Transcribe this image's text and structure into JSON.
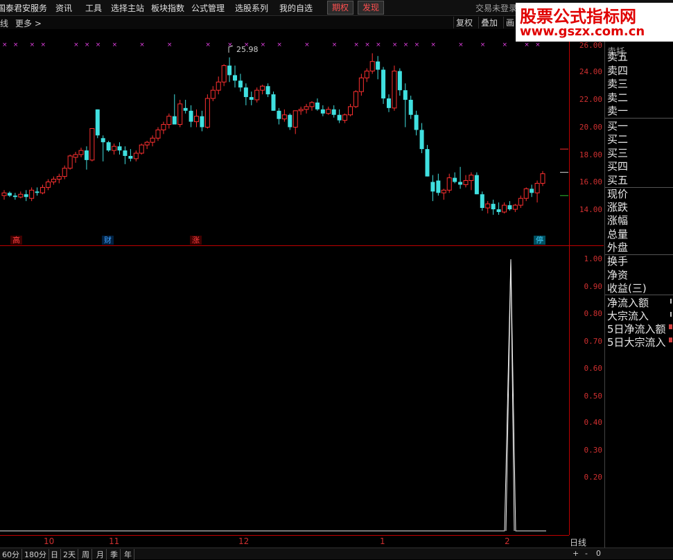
{
  "menu": {
    "items": [
      "国泰君安服务",
      "资讯",
      "工具",
      "选择主站",
      "板块指数",
      "公式管理",
      "选股系列",
      "我的自选"
    ],
    "buttons": [
      "期权",
      "发现"
    ],
    "status": "交易未登录"
  },
  "watermark": {
    "title": "股票公式指标网",
    "url": "www.gszx.com.cn"
  },
  "subbar": {
    "left_label": "线",
    "more_label": "更多",
    "more_icon": "chevron-right-icon",
    "buttons": [
      "复权",
      "叠加",
      "画"
    ]
  },
  "main_axis": {
    "ticks": [
      "26.00",
      "24.00",
      "22.00",
      "20.00",
      "18.00",
      "16.00",
      "14.00"
    ]
  },
  "sub_axis": {
    "ticks": [
      "1.00",
      "0.90",
      "0.80",
      "0.70",
      "0.60",
      "0.50",
      "0.40",
      "0.30",
      "0.20"
    ]
  },
  "badges": [
    {
      "text": "高",
      "color": "#ff4040"
    },
    {
      "text": "财",
      "color": "#40a0ff"
    },
    {
      "text": "涨",
      "color": "#ff4040"
    },
    {
      "text": "停",
      "color": "#40d0ff"
    }
  ],
  "annotation": {
    "high_label": "25.98"
  },
  "right_panel": {
    "top_label": "卖托",
    "sell": [
      "卖五",
      "卖四",
      "卖三",
      "卖二",
      "卖一"
    ],
    "buy": [
      "买一",
      "买二",
      "买三",
      "买四",
      "买五"
    ],
    "stats": [
      "现价",
      "涨跌",
      "涨幅",
      "总量",
      "外盘"
    ],
    "stats2": [
      "换手",
      "净资",
      "收益(三)"
    ],
    "flows": [
      "净流入额",
      "大宗流入",
      "5日净流入额",
      "5日大宗流入"
    ]
  },
  "xaxis": {
    "labels": [
      "10",
      "11",
      "12",
      "1",
      "2"
    ]
  },
  "period_label": "日线",
  "bottom_tabs": [
    "60分",
    "180分",
    "日",
    "2天",
    "周",
    "月",
    "季",
    "年"
  ],
  "zoom": {
    "plus": "+",
    "minus": "-",
    "value": "0"
  },
  "chart_data": [
    {
      "type": "candlestick",
      "title": "",
      "ylim": [
        13,
        26.3
      ],
      "ticks": [
        14,
        16,
        18,
        20,
        22,
        24,
        26
      ],
      "grid": false,
      "up_color": "#ff3030",
      "down_color": "#40e0e0",
      "candles": [
        [
          15.0,
          15.4,
          14.7,
          15.2
        ],
        [
          15.2,
          15.3,
          14.9,
          15.0
        ],
        [
          15.0,
          15.2,
          14.7,
          14.9
        ],
        [
          14.9,
          15.3,
          14.8,
          15.1
        ],
        [
          15.1,
          15.4,
          14.6,
          14.9
        ],
        [
          14.8,
          15.6,
          14.6,
          15.4
        ],
        [
          15.3,
          15.6,
          15.0,
          15.2
        ],
        [
          15.2,
          15.8,
          15.1,
          15.6
        ],
        [
          15.6,
          16.2,
          15.4,
          16.0
        ],
        [
          16.0,
          16.4,
          15.8,
          16.2
        ],
        [
          16.2,
          16.6,
          15.9,
          16.4
        ],
        [
          16.4,
          17.2,
          16.2,
          17.0
        ],
        [
          17.0,
          18.0,
          16.9,
          17.9
        ],
        [
          17.8,
          18.2,
          17.4,
          18.0
        ],
        [
          18.0,
          18.5,
          17.8,
          18.3
        ],
        [
          18.3,
          18.6,
          16.9,
          17.6
        ],
        [
          17.6,
          19.8,
          17.5,
          19.9
        ],
        [
          21.3,
          21.3,
          19.2,
          19.4
        ],
        [
          19.2,
          19.4,
          17.5,
          18.9
        ],
        [
          18.9,
          19.0,
          18.2,
          18.3
        ],
        [
          18.3,
          18.8,
          18.0,
          18.6
        ],
        [
          18.6,
          18.9,
          18.0,
          18.3
        ],
        [
          18.3,
          18.6,
          17.3,
          17.9
        ],
        [
          17.9,
          18.4,
          17.5,
          17.7
        ],
        [
          17.7,
          18.3,
          17.5,
          18.1
        ],
        [
          18.1,
          18.8,
          18.0,
          18.7
        ],
        [
          18.7,
          19.0,
          18.4,
          18.9
        ],
        [
          18.9,
          19.4,
          18.6,
          19.2
        ],
        [
          19.2,
          20.0,
          19.0,
          19.8
        ],
        [
          19.8,
          20.4,
          19.5,
          20.2
        ],
        [
          20.2,
          21.0,
          19.9,
          20.8
        ],
        [
          20.8,
          22.4,
          20.3,
          20.2
        ],
        [
          20.2,
          22.0,
          20.0,
          21.7
        ],
        [
          21.4,
          22.0,
          21.0,
          21.2
        ],
        [
          21.2,
          21.6,
          20.0,
          20.4
        ],
        [
          20.4,
          21.3,
          20.0,
          20.8
        ],
        [
          20.8,
          21.2,
          19.7,
          20.0
        ],
        [
          20.0,
          22.4,
          19.9,
          22.1
        ],
        [
          22.1,
          23.0,
          21.9,
          22.7
        ],
        [
          22.7,
          23.7,
          22.4,
          23.3
        ],
        [
          23.3,
          24.6,
          23.0,
          24.5
        ],
        [
          24.5,
          25.1,
          23.3,
          23.8
        ],
        [
          23.8,
          24.5,
          22.9,
          23.4
        ],
        [
          23.4,
          23.9,
          22.6,
          22.9
        ],
        [
          22.9,
          23.2,
          21.6,
          22.2
        ],
        [
          22.2,
          22.6,
          21.6,
          22.0
        ],
        [
          22.0,
          22.9,
          21.8,
          22.7
        ],
        [
          22.7,
          23.1,
          22.4,
          23.0
        ],
        [
          23.0,
          23.2,
          22.2,
          22.4
        ],
        [
          22.4,
          22.6,
          21.2,
          21.2
        ],
        [
          21.2,
          21.4,
          20.2,
          20.6
        ],
        [
          20.6,
          21.3,
          20.4,
          20.9
        ],
        [
          20.9,
          21.0,
          19.8,
          20.0
        ],
        [
          20.0,
          21.2,
          19.5,
          21.2
        ],
        [
          21.2,
          21.5,
          20.9,
          21.3
        ],
        [
          21.3,
          21.7,
          21.0,
          21.5
        ],
        [
          21.5,
          21.9,
          21.2,
          21.8
        ],
        [
          21.8,
          22.1,
          21.2,
          21.3
        ],
        [
          21.3,
          21.6,
          20.8,
          21.0
        ],
        [
          21.0,
          21.5,
          20.9,
          21.3
        ],
        [
          21.3,
          21.6,
          20.7,
          20.9
        ],
        [
          20.9,
          21.3,
          20.3,
          20.5
        ],
        [
          20.5,
          21.0,
          20.3,
          20.9
        ],
        [
          20.9,
          21.7,
          20.8,
          21.5
        ],
        [
          21.5,
          22.7,
          21.4,
          22.6
        ],
        [
          22.6,
          23.9,
          22.3,
          23.6
        ],
        [
          23.6,
          24.3,
          23.3,
          24.1
        ],
        [
          24.1,
          25.4,
          23.9,
          24.8
        ],
        [
          24.8,
          25.2,
          23.5,
          24.2
        ],
        [
          24.2,
          24.4,
          21.7,
          22.1
        ],
        [
          22.1,
          22.4,
          21.1,
          21.4
        ],
        [
          21.4,
          24.5,
          21.2,
          24.1
        ],
        [
          24.1,
          24.3,
          22.3,
          22.7
        ],
        [
          22.7,
          23.2,
          20.0,
          22.0
        ],
        [
          22.0,
          22.3,
          20.6,
          20.9
        ],
        [
          20.9,
          21.2,
          19.4,
          19.8
        ],
        [
          19.8,
          20.3,
          18.1,
          18.4
        ],
        [
          18.4,
          18.7,
          16.4,
          16.4
        ],
        [
          16.0,
          16.5,
          14.6,
          15.3
        ],
        [
          16.1,
          16.6,
          15.0,
          15.2
        ],
        [
          15.2,
          15.5,
          14.7,
          15.4
        ],
        [
          15.4,
          16.6,
          15.2,
          16.3
        ],
        [
          16.3,
          16.7,
          15.9,
          16.0
        ],
        [
          16.0,
          17.1,
          15.5,
          15.8
        ],
        [
          15.8,
          16.5,
          15.6,
          16.1
        ],
        [
          16.1,
          16.7,
          15.4,
          16.5
        ],
        [
          16.5,
          16.7,
          15.1,
          15.1
        ],
        [
          15.1,
          15.3,
          13.9,
          14.1
        ],
        [
          14.1,
          14.6,
          13.7,
          14.4
        ],
        [
          14.4,
          14.7,
          13.6,
          14.0
        ],
        [
          14.0,
          14.5,
          13.6,
          13.8
        ],
        [
          13.8,
          14.5,
          13.7,
          14.3
        ],
        [
          14.3,
          14.6,
          13.9,
          14.0
        ],
        [
          14.0,
          14.4,
          13.8,
          14.3
        ],
        [
          14.3,
          15.0,
          14.1,
          14.8
        ],
        [
          14.8,
          15.6,
          14.6,
          15.5
        ],
        [
          15.5,
          15.8,
          14.9,
          15.2
        ],
        [
          15.2,
          16.1,
          14.5,
          15.9
        ],
        [
          15.9,
          16.8,
          15.7,
          16.6
        ]
      ]
    },
    {
      "type": "line",
      "title": "",
      "ylim": [
        0,
        1.05
      ],
      "ticks": [
        0.2,
        0.3,
        0.4,
        0.5,
        0.6,
        0.7,
        0.8,
        0.9,
        1.0
      ],
      "grid": false,
      "series": [
        {
          "values_desc": "spike",
          "values": [
            0,
            0,
            0,
            1,
            0,
            0,
            0
          ],
          "x": [
            0,
            722,
            728,
            737,
            744,
            750,
            788
          ]
        }
      ]
    }
  ]
}
